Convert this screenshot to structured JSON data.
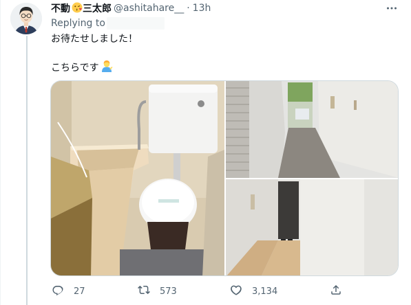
{
  "tweet": {
    "display_name": "不動",
    "display_name_suffix": "三太郎",
    "handle": "@ashitahare__",
    "separator": "·",
    "time": "13h",
    "replying_label": "Replying to",
    "text_line1": "お待たせしました！",
    "text_line2": "こちらです"
  },
  "metrics": {
    "replies": "27",
    "retweets": "573",
    "likes": "3,134"
  },
  "colors": {
    "secondary_text": "#536471",
    "thread_line": "#cfd9de"
  },
  "icons": [
    "avatar-illustration",
    "kissing-face-emoji",
    "more-icon",
    "person-tipping-hand-emoji",
    "reply-icon",
    "retweet-icon",
    "like-icon",
    "share-icon"
  ]
}
